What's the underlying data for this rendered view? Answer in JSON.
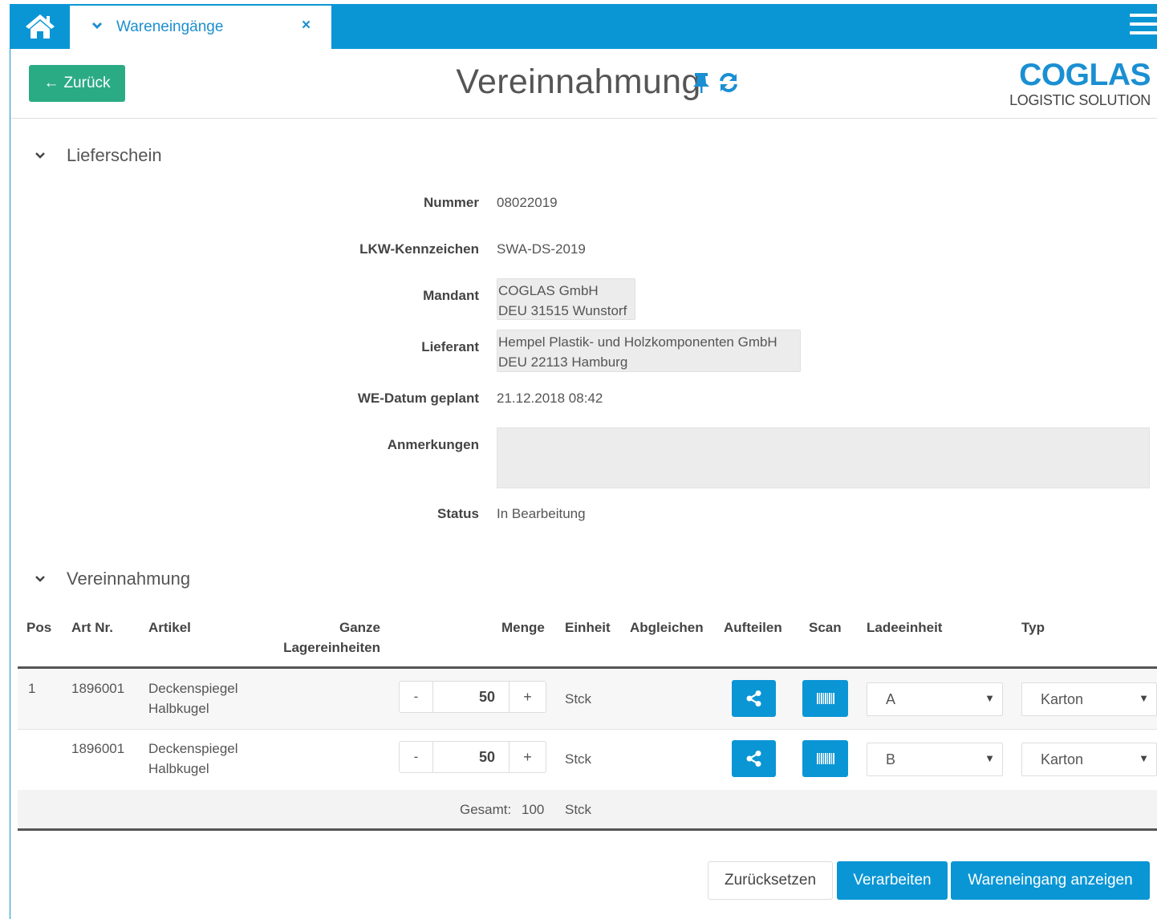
{
  "topbar": {
    "home_icon": "home-icon",
    "tab_label": "Wareneingänge",
    "tab_close": "×",
    "menu_icon": "hamburger-menu-icon"
  },
  "header": {
    "back_label": "Zurück",
    "title": "Vereinnahmung",
    "logo_brand": "COGLAS",
    "logo_sub": "LOGISTIC SOLUTION"
  },
  "delivery_note": {
    "section_title": "Lieferschein",
    "fields": {
      "nummer_label": "Nummer",
      "nummer_value": "08022019",
      "lkw_label": "LKW-Kennzeichen",
      "lkw_value": "SWA-DS-2019",
      "mandant_label": "Mandant",
      "mandant_line1": "COGLAS GmbH",
      "mandant_line2": "DEU 31515 Wunstorf",
      "lieferant_label": "Lieferant",
      "lieferant_line1": "Hempel Plastik- und Holzkomponenten GmbH",
      "lieferant_line2": "DEU 22113 Hamburg",
      "we_datum_label": "WE-Datum geplant",
      "we_datum_value": "21.12.2018 08:42",
      "anmerkungen_label": "Anmerkungen",
      "anmerkungen_value": "",
      "status_label": "Status",
      "status_value": "In Bearbeitung"
    }
  },
  "receipt": {
    "section_title": "Vereinnahmung",
    "columns": {
      "pos": "Pos",
      "art_nr": "Art Nr.",
      "artikel": "Artikel",
      "ganze_1": "Ganze",
      "ganze_2": "Lagereinheiten",
      "menge": "Menge",
      "einheit": "Einheit",
      "abgleichen": "Abgleichen",
      "aufteilen": "Aufteilen",
      "scan": "Scan",
      "ladeeinheit": "Ladeeinheit",
      "typ": "Typ"
    },
    "rows": [
      {
        "pos": "1",
        "art_nr": "1896001",
        "artikel_1": "Deckenspiegel",
        "artikel_2": "Halbkugel",
        "minus": "-",
        "menge": "50",
        "plus": "+",
        "einheit": "Stck",
        "ladeeinheit": "A",
        "typ": "Karton"
      },
      {
        "pos": "",
        "art_nr": "1896001",
        "artikel_1": "Deckenspiegel",
        "artikel_2": "Halbkugel",
        "minus": "-",
        "menge": "50",
        "plus": "+",
        "einheit": "Stck",
        "ladeeinheit": "B",
        "typ": "Karton"
      }
    ],
    "total_label": "Gesamt:",
    "total_value": "100",
    "total_unit": "Stck"
  },
  "actions": {
    "reset": "Zurücksetzen",
    "process": "Verarbeiten",
    "show": "Wareneingang anzeigen"
  },
  "colors": {
    "primary": "#0a96d5",
    "back_button": "#2bab84",
    "brand": "#1a8fd2"
  }
}
